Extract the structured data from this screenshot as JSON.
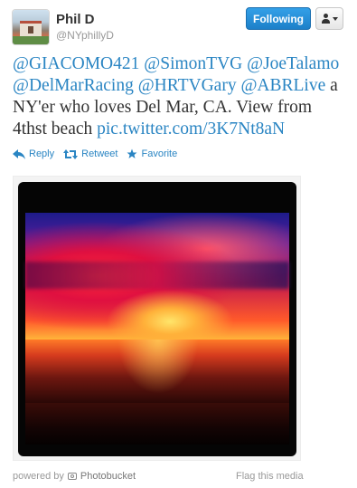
{
  "author": {
    "name": "Phil D",
    "handle": "@NYphillyD"
  },
  "buttons": {
    "follow_label": "Following",
    "user_menu_icon": "person-caret-icon"
  },
  "tweet": {
    "mention_1": "@GIACOMO421",
    "mention_2": "@SimonTVG",
    "mention_3": "@JoeTalamo",
    "mention_4": "@DelMarRacing",
    "mention_5": "@HRTVGary",
    "mention_6": "@ABRLive",
    "text_1": " a NY'er who loves Del Mar, CA. View from 4thst beach ",
    "link": "pic.twitter.com/3K7Nt8aN"
  },
  "actions": {
    "reply": "Reply",
    "retweet": "Retweet",
    "favorite": "Favorite"
  },
  "media": {
    "powered_by": "powered by",
    "provider": "Photobucket",
    "flag": "Flag this media"
  },
  "colors": {
    "link": "#2a85c3",
    "follow_button": "#1d80c9",
    "muted_text": "#999999"
  }
}
